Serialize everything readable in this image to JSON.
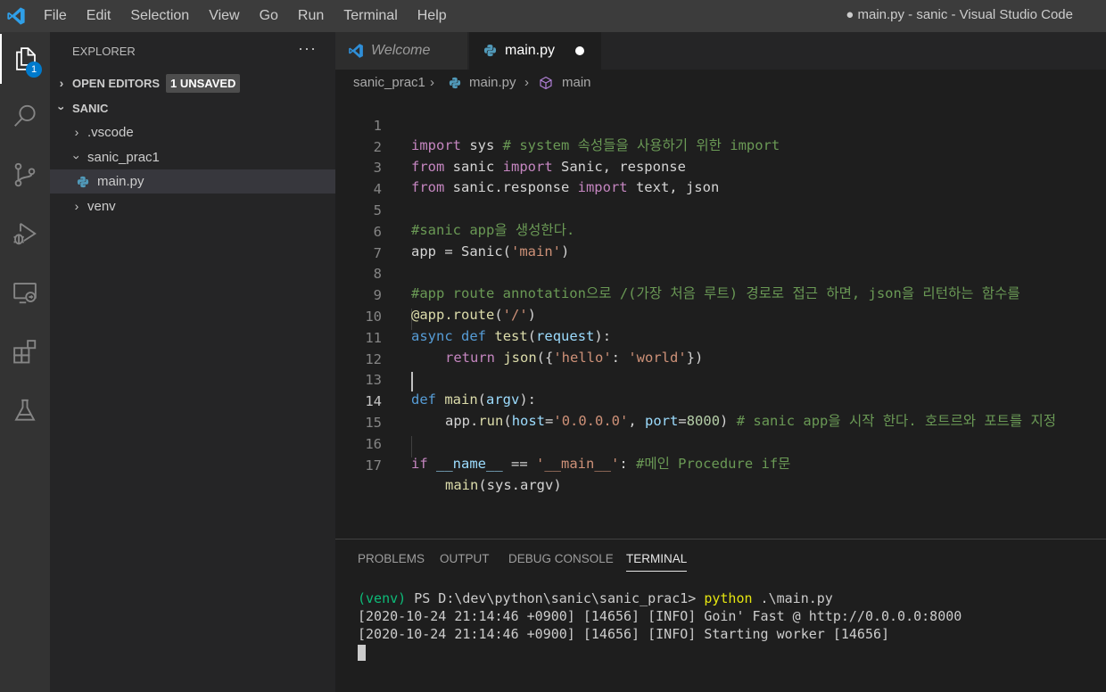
{
  "menu": [
    "File",
    "Edit",
    "Selection",
    "View",
    "Go",
    "Run",
    "Terminal",
    "Help"
  ],
  "window_title": "● main.py - sanic - Visual Studio Code",
  "activity": {
    "explorer_badge": "1"
  },
  "sidebar": {
    "header": "EXPLORER",
    "more": "···",
    "open_editors": "OPEN EDITORS",
    "unsaved_badge": "1 UNSAVED",
    "workspace": "SANIC",
    "tree": [
      ".vscode",
      "sanic_prac1",
      "main.py",
      "venv"
    ]
  },
  "tabs": {
    "welcome": "Welcome",
    "active": "main.py"
  },
  "breadcrumb": [
    "sanic_prac1",
    "main.py",
    "main"
  ],
  "editor": {
    "line_numbers": [
      "1",
      "2",
      "3",
      "4",
      "5",
      "6",
      "7",
      "8",
      "9",
      "10",
      "11",
      "12",
      "13",
      "14",
      "15",
      "16",
      "17"
    ],
    "l1": [
      "import",
      " sys ",
      "# system 속성들을 사용하기 위한 import"
    ],
    "l2": [
      "from",
      " sanic ",
      "import",
      " Sanic, response"
    ],
    "l3": [
      "from",
      " sanic.response ",
      "import",
      " text, json"
    ],
    "l5": "#sanic app을 생성한다.",
    "l6": [
      "app",
      " = ",
      "Sanic",
      "(",
      "'main'",
      ")"
    ],
    "l8": "#app route annotation으로 /(가장 처음 루트) 경로로 접근 하면, json을 리턴하는 함수를",
    "l9": [
      "@app.route",
      "(",
      "'/'",
      ")"
    ],
    "l10": [
      "async",
      " ",
      "def",
      " ",
      "test",
      "(",
      "request",
      "):"
    ],
    "l11": [
      "return",
      " ",
      "json",
      "({",
      "'hello'",
      ": ",
      "'world'",
      "})"
    ],
    "l13": [
      "def",
      " ",
      "main",
      "(",
      "argv",
      "):"
    ],
    "l14": [
      "app",
      ".",
      "run",
      "(",
      "host",
      "=",
      "'0.0.0.0'",
      ", ",
      "port",
      "=",
      "8000",
      ") ",
      "# sanic app을 시작 한다. 호트르와 포트를 지정"
    ],
    "l16": [
      "if",
      " ",
      "__name__",
      " == ",
      "'__main__'",
      ": ",
      "#메인 Procedure if문"
    ],
    "l17": [
      "main",
      "(",
      "sys",
      ".",
      "argv",
      ")"
    ]
  },
  "panel": {
    "tabs": [
      "PROBLEMS",
      "OUTPUT",
      "DEBUG CONSOLE",
      "TERMINAL"
    ],
    "terminal": {
      "prompt_env": "(venv)",
      "prompt_path": " PS D:\\dev\\python\\sanic\\sanic_prac1> ",
      "cmd_exe": "python",
      "cmd_arg": " .\\main.py",
      "log1": "[2020-10-24 21:14:46 +0900] [14656] [INFO] Goin' Fast @ http://0.0.0.0:8000",
      "log2": "[2020-10-24 21:14:46 +0900] [14656] [INFO] Starting worker [14656]"
    }
  },
  "colors": {
    "accent": "#007acc",
    "titlebar": "#3c3c3c",
    "activitybar": "#333333",
    "sidebar": "#252526",
    "editor": "#1e1e1e"
  }
}
